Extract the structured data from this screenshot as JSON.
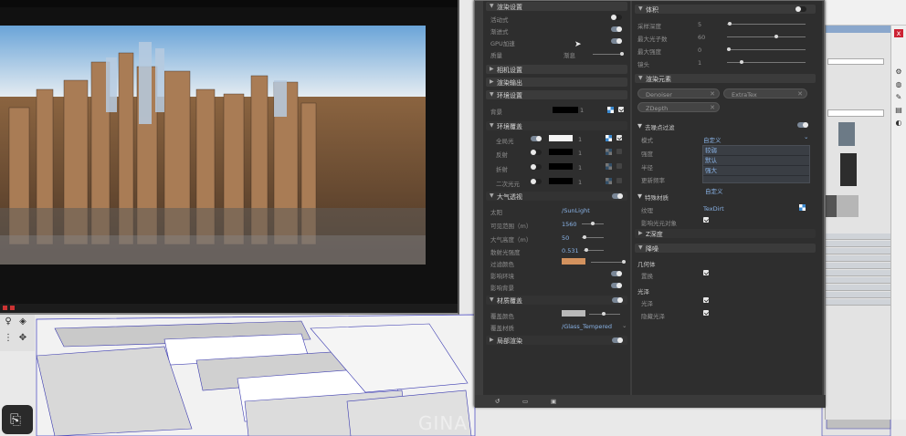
{
  "left_panel": {
    "render_settings": "渲染设置",
    "active": "活动式",
    "progressive": "渐进式",
    "gpu": "GPU加速",
    "quality": "质量",
    "quality_value": "渐息",
    "camera_settings": "相机设置",
    "render_output": "渲染输出",
    "environment_settings": "环境设置",
    "background": "背景",
    "background_value": "1",
    "env_override": "环境覆盖",
    "global_illum": "全局光",
    "global_illum_value": "1",
    "reflection": "反射",
    "reflection_value": "1",
    "refraction": "折射",
    "refraction_value": "1",
    "secondary_light": "二次光元",
    "secondary_light_value": "1",
    "atmosphere": "大气透视",
    "sun": "太阳",
    "sun_value": "/SunLight",
    "visibility": "可见范围（m）",
    "visibility_value": "1560",
    "atmo_height": "大气高度（m）",
    "atmo_height_value": "50",
    "sun_intensity": "散射光强度",
    "sun_intensity_value": "0.531",
    "filter_color": "过滤颜色",
    "affect_env": "影响环境",
    "affect_bg": "影响背景",
    "material_override": "材质覆盖",
    "override_color": "覆盖颜色",
    "override_material": "覆盖材质",
    "override_material_value": "/Glass_Tempered",
    "region_render": "局部渲染"
  },
  "right_panel": {
    "volume": "体积",
    "sampling_depth": "采样深度",
    "sampling_depth_value": "5",
    "max_lights": "最大光子数",
    "max_lights_value": "60",
    "max_intensity": "最大强度",
    "max_intensity_value": "0",
    "lens": "镜头",
    "lens_value": "1",
    "render_elements": "渲染元素",
    "tag1": "Denoiser",
    "tag2": "ExtraTex",
    "tag3": "ZDepth",
    "denoise_filter": "去噪点过滤",
    "mode": "模式",
    "mode_value": "自定义",
    "strength": "强度",
    "radius": "半径",
    "preset": "更新频率",
    "dd_options": [
      "较弱",
      "默认",
      "强大",
      "自定义"
    ],
    "special_material": "特殊材质",
    "texture": "纹理",
    "texture_value": "TexDirt",
    "affect_all": "影响光元对象",
    "z_depth": "Z深度",
    "denoise": "降噪",
    "geometry": "几何体",
    "displacement": "置换",
    "gloss": "光泽",
    "gloss_item": "光泽",
    "glossy_refl": "隐藏光泽"
  },
  "overlay": {
    "watermark": "GINA"
  },
  "colors": {
    "accent": "#8ab4e8",
    "filter_swatch": "#d3925e",
    "override_swatch": "#b9b9b9"
  }
}
